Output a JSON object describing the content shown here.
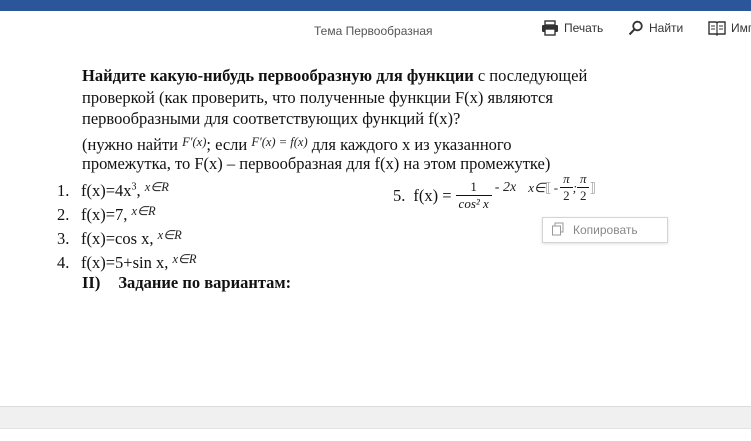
{
  "header": {
    "doc_title": "Тема Первообразная",
    "print_label": "Печать",
    "find_label": "Найти",
    "other_label": "Имп"
  },
  "document": {
    "line1_bold": "Найдите какую-нибудь первообразную для функции",
    "line1_rest": " с последующей",
    "line2": "проверкой (как проверить, что полученные функции F(x) являются",
    "line3": "первообразными для соответствующих функций f(x)?",
    "line4_start": "(нужно найти ",
    "line4_formula1": "F′(x)",
    "line4_mid": "; если ",
    "line4_formula2": "F′(x) = f(x)",
    "line4_end": " для каждого х из указанного",
    "line5": "промежутка, то F(x) – первообразная для f(x) на этом промежутке)",
    "items": [
      {
        "num": "1.",
        "text_a": "f(x)=4x",
        "sup": "3",
        "text_b": ", ",
        "domain": "x∈R"
      },
      {
        "num": "2.",
        "text_a": "f(x)=7, ",
        "sup": "",
        "text_b": "",
        "domain": "x∈R"
      },
      {
        "num": "3.",
        "text_a": "f(x)=cos x, ",
        "sup": "",
        "text_b": "",
        "domain": "x∈R"
      },
      {
        "num": "4.",
        "text_a": "f(x)=5+sin x, ",
        "sup": "",
        "text_b": "",
        "domain": "x∈R"
      }
    ],
    "item5": {
      "num": "5.",
      "lhs": "f(x) =",
      "numerator": "1",
      "denominator": "cos² x",
      "tail": "- 2x",
      "domain_start": "x∈",
      "bracket_open": "⟦",
      "neg": "-",
      "pi": "π",
      "two": "2",
      "sep": ";",
      "bracket_close": "⟧"
    },
    "section_num": "II)",
    "section_title": "Задание по вариантам:"
  },
  "popup": {
    "copy_label": "Копировать"
  },
  "colors": {
    "topbar": "#2b579a",
    "text": "#111111",
    "muted": "#888888"
  }
}
